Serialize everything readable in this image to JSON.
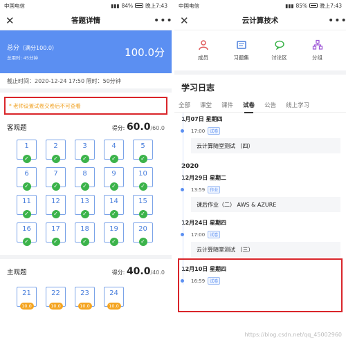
{
  "left": {
    "status": {
      "carrier": "中国电信",
      "battery": "84%",
      "time": "晚上7:43"
    },
    "title": "答题详情",
    "close_icon": "close-icon",
    "more_icon": "more-icon",
    "more_label": "•••",
    "close_label": "✕",
    "score_card": {
      "label": "总分",
      "full": "（满分100.0）",
      "time_used": "总用时: 45分钟",
      "total": "100.0分"
    },
    "deadline": "截止时间：2020-12-24 17:50 限时：50分钟",
    "notice": "* 老师设置试卷交卷后不可查看",
    "objective": {
      "name": "客观题",
      "score_prefix": "得分: ",
      "score": "60.0",
      "denominator": "/60.0",
      "questions": [
        "1",
        "2",
        "3",
        "4",
        "5",
        "6",
        "7",
        "8",
        "9",
        "10",
        "11",
        "12",
        "13",
        "14",
        "15",
        "16",
        "17",
        "18",
        "19",
        "20"
      ]
    },
    "subjective": {
      "name": "主观题",
      "score_prefix": "得分: ",
      "score": "40.0",
      "denominator": "/40.0",
      "questions": [
        "21",
        "22",
        "23",
        "24"
      ],
      "points": [
        "10.0",
        "10.0",
        "10.0",
        "10.0"
      ]
    },
    "accent": "#5b8ff2",
    "correct_color": "#3bb34a",
    "points_color": "#f4a522",
    "highlight_color": "#d9252a"
  },
  "right": {
    "status": {
      "carrier": "中国电信",
      "battery": "85%",
      "time": "晚上7:43"
    },
    "title": "云计算技术",
    "close_label": "✕",
    "more_label": "•••",
    "modules": [
      {
        "label": "成员",
        "icon": "members-icon"
      },
      {
        "label": "习题集",
        "icon": "exercise-icon"
      },
      {
        "label": "讨论区",
        "icon": "discussion-icon"
      },
      {
        "label": "分组",
        "icon": "group-icon"
      }
    ],
    "log_title": "学习日志",
    "tabs": [
      "全部",
      "课堂",
      "课件",
      "试卷",
      "公告",
      "线上学习"
    ],
    "active_tab": "试卷",
    "entries": [
      {
        "date": "1月07日   星期四",
        "time": "17:00",
        "tag": "试卷",
        "title": "云计算随堂测试 （四）"
      },
      {
        "year": "2020"
      },
      {
        "date": "12月29日   星期二",
        "time": "13:59",
        "tag": "作业",
        "title": "课后作业（二） AWS & AZURE"
      },
      {
        "date": "12月24日   星期四",
        "time": "17:00",
        "tag": "试卷",
        "title": "云计算随堂测试 （三）"
      },
      {
        "date": "12月10日   星期四",
        "time": "16:59",
        "tag": "试卷"
      }
    ],
    "watermark": "https://blog.csdn.net/qq_45002960"
  }
}
